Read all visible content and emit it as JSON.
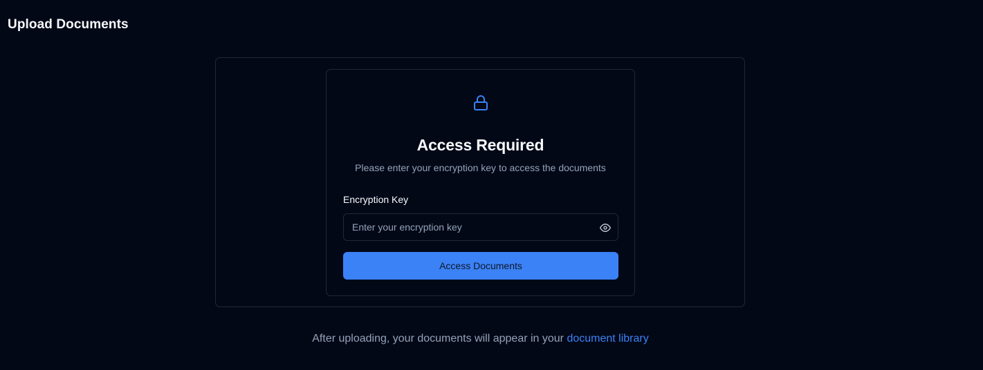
{
  "page": {
    "title": "Upload Documents"
  },
  "auth_card": {
    "icon": "lock-icon",
    "heading": "Access Required",
    "subtext": "Please enter your encryption key to access the documents",
    "key_label": "Encryption Key",
    "key_value": "",
    "key_placeholder": "Enter your encryption key",
    "toggle_icon": "eye-icon",
    "submit_label": "Access Documents"
  },
  "footer": {
    "text": "After uploading, your documents will appear in your ",
    "link_text": "document library"
  },
  "colors": {
    "background": "#030817",
    "border": "#1f2937",
    "accent": "#3b82f6",
    "muted_text": "#94a3b8",
    "primary_text": "#f8fafc"
  }
}
